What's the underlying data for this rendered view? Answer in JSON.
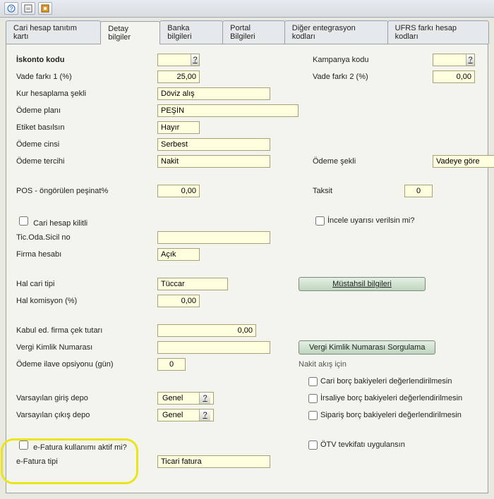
{
  "toolbar": {
    "icons": [
      "help-icon",
      "save-icon",
      "ledger-icon"
    ]
  },
  "tabs": [
    "Cari hesap tanıtım kartı",
    "Detay bilgiler",
    "Banka bilgileri",
    "Portal Bilgileri",
    "Diğer entegrasyon kodları",
    "UFRS farkı hesap kodları"
  ],
  "activeTab": 1,
  "labels": {
    "iskonto_kodu": "İskonto kodu",
    "kampanya_kodu": "Kampanya kodu",
    "vade_farki_1": "Vade farkı 1 (%)",
    "vade_farki_2": "Vade farkı 2 (%)",
    "kur_hesap": "Kur hesaplama şekli",
    "odeme_plani": "Ödeme planı",
    "etiket_basilsin": "Etiket basılsın",
    "odeme_cinsi": "Ödeme cinsi",
    "odeme_tercihi": "Ödeme tercihi",
    "odeme_sekli": "Ödeme şekli",
    "pos_pesinat": "POS - öngörülen peşinat%",
    "taksit": "Taksit",
    "cari_kilitli": "Cari hesap kilitli",
    "incele_uyari": "İncele uyarısı verilsin mi?",
    "tic_oda": "Tic.Oda.Sicil no",
    "firma_hesabi": "Firma hesabı",
    "hal_cari_tipi": "Hal cari tipi",
    "mustahsil_btn": "Müstahsil bilgileri",
    "hal_komisyon": "Hal komisyon (%)",
    "kabul_cek": "Kabul ed. firma çek tutarı",
    "vergi_kimlik": "Vergi Kimlik Numarası",
    "vergi_sorgu_btn": "Vergi Kimlik Numarası Sorgulama",
    "odeme_ilave": "Ödeme ilave opsiyonu (gün)",
    "nakit_akis": "Nakit akış için",
    "cari_borc_bak": "Cari borç bakiyeleri değerlendirilmesin",
    "vars_giris": "Varsayılan giriş depo",
    "irsaliye_borc": "İrsaliye borç bakiyeleri değerlendirilmesin",
    "vars_cikis": "Varsayılan çıkış depo",
    "siparis_borc": "Sipariş borç bakiyeleri değerlendirilmesin",
    "efatura_aktif": "e-Fatura kullanımı aktif mi?",
    "otv_tevkifat": "ÖTV tevkifatı uygulansın",
    "efatura_tipi": "e-Fatura tipi"
  },
  "values": {
    "iskonto_kodu": "",
    "kampanya_kodu": "",
    "vade_farki_1": "25,00",
    "vade_farki_2": "0,00",
    "kur_hesap": "Döviz alış",
    "odeme_plani": "PEŞİN",
    "etiket_basilsin": "Hayır",
    "odeme_cinsi": "Serbest",
    "odeme_tercihi": "Nakit",
    "odeme_sekli": "Vadeye göre",
    "pos_pesinat": "0,00",
    "taksit": "0",
    "tic_oda": "",
    "firma_hesabi": "Açık",
    "hal_cari_tipi": "Tüccar",
    "hal_komisyon": "0,00",
    "kabul_cek": "0,00",
    "vergi_kimlik": "",
    "odeme_ilave": "0",
    "vars_giris": "Genel",
    "vars_cikis": "Genel",
    "efatura_tipi": "Ticari fatura"
  }
}
